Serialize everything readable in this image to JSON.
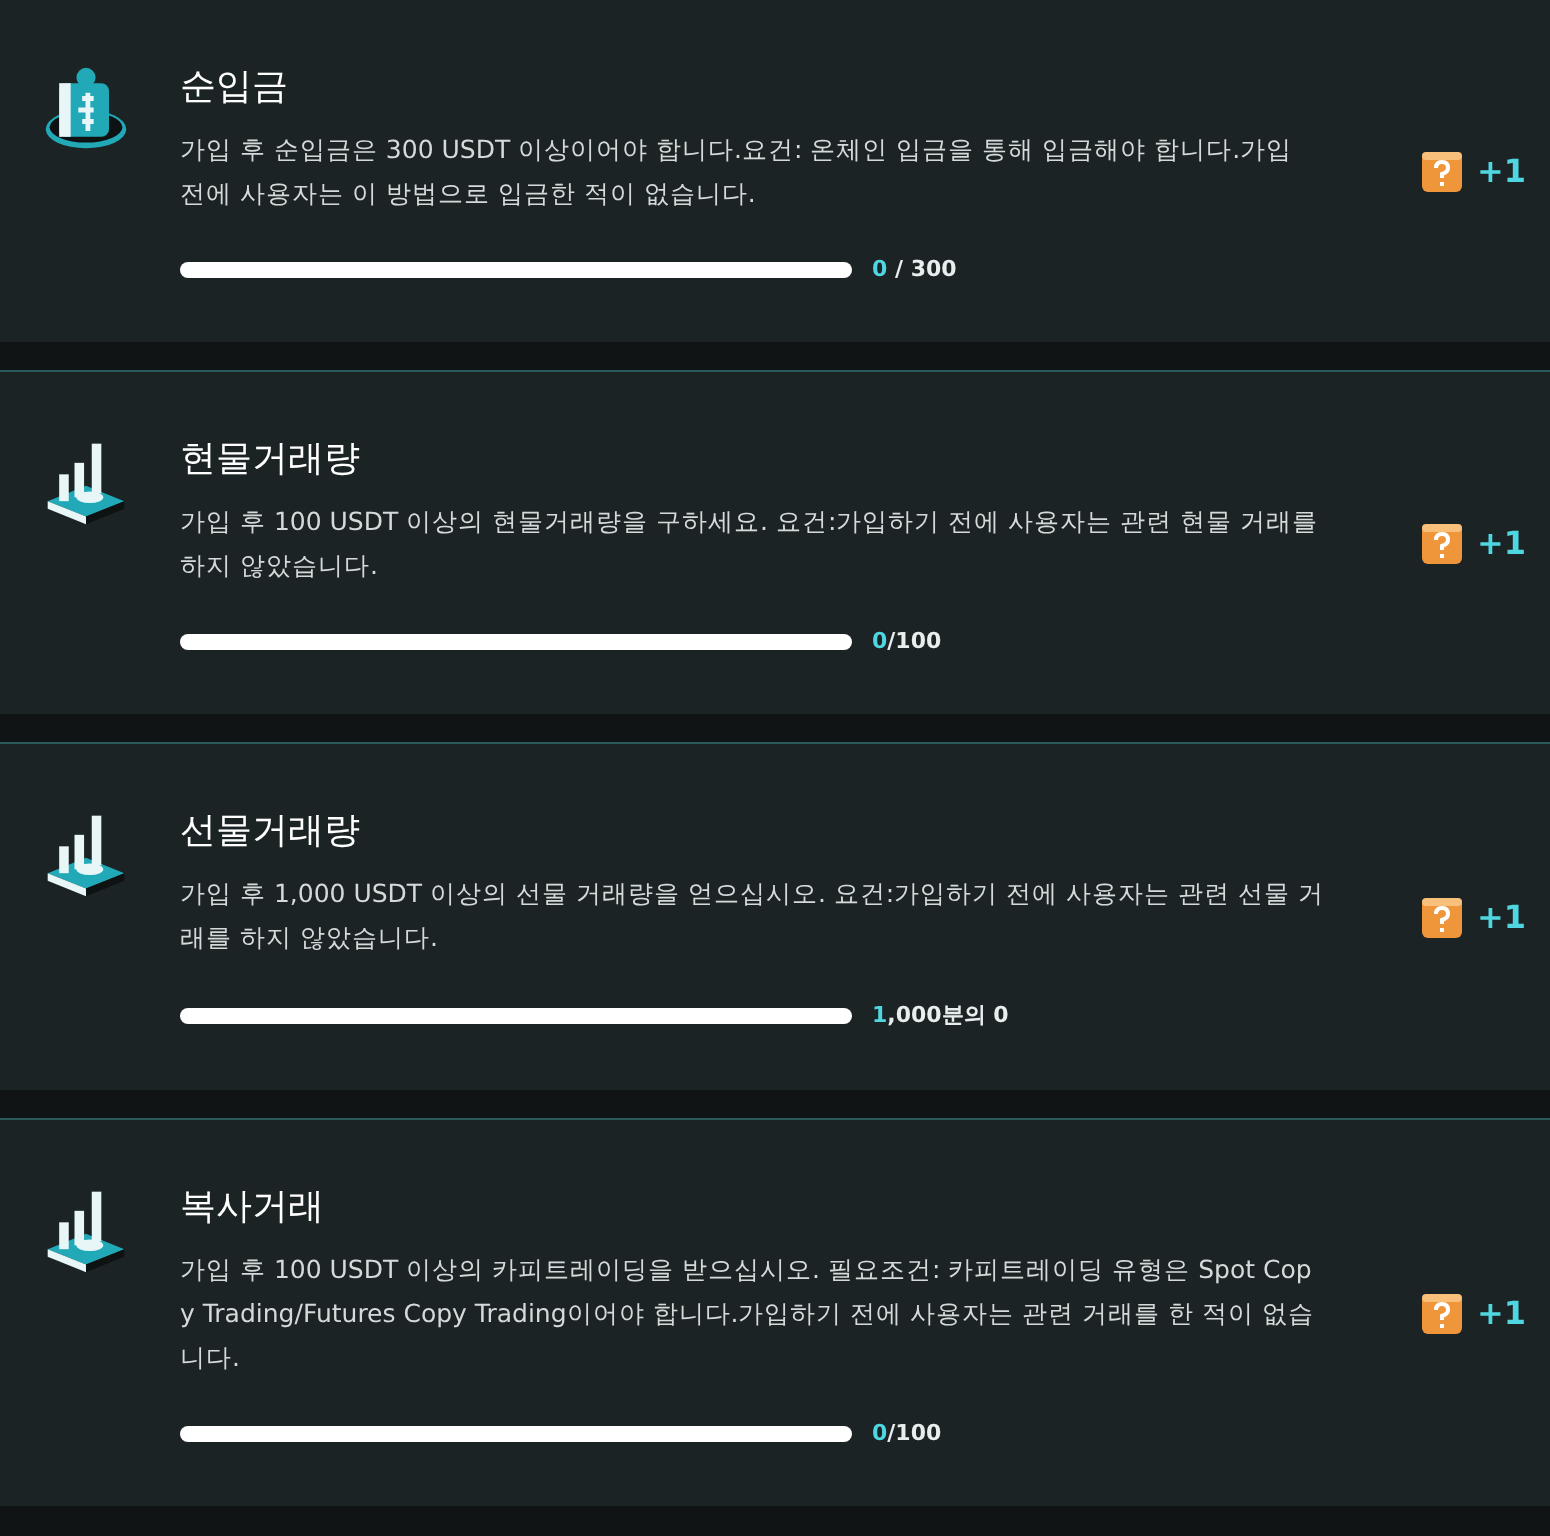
{
  "tasks": [
    {
      "title": "순입금",
      "description": "가입 후 순입금은 300 USDT 이상이어야 합니다.요건: 온체인 입금을 통해 입금해야 합니다.가입 전에 사용자는 이 방법으로 입금한 적이 없습니다.",
      "level": 0,
      "progress_current": "0",
      "progress_rest": " / 300",
      "reward": "+1",
      "kind": "wallet"
    },
    {
      "title": "현물거래량",
      "description": "가입 후 100 USDT 이상의 현물거래량을 구하세요. 요건:가입하기 전에 사용자는 관련 현물 거래를 하지 않았습니다.",
      "level": 0,
      "progress_current": "0",
      "progress_rest": "/100",
      "reward": "+1",
      "kind": "chart"
    },
    {
      "title": "선물거래량",
      "description": "가입 후 1,000 USDT 이상의 선물 거래량을 얻으십시오. 요건:가입하기 전에 사용자는 관련 선물 거래를 하지 않았습니다.",
      "level": 0,
      "progress_current": "1",
      "progress_rest": ",000분의 0",
      "reward": "+1",
      "kind": "chart"
    },
    {
      "title": "복사거래",
      "description": "가입 후 100 USDT 이상의 카피트레이딩을 받으십시오. 필요조건: 카피트레이딩 유형은 Spot Copy Trading/Futures Copy Trading이어야 합니다.가입하기 전에 사용자는 관련 거래를 한 적이 없습니다.",
      "level": 0,
      "progress_current": "0",
      "progress_rest": "/100",
      "reward": "+1",
      "kind": "chart"
    }
  ]
}
